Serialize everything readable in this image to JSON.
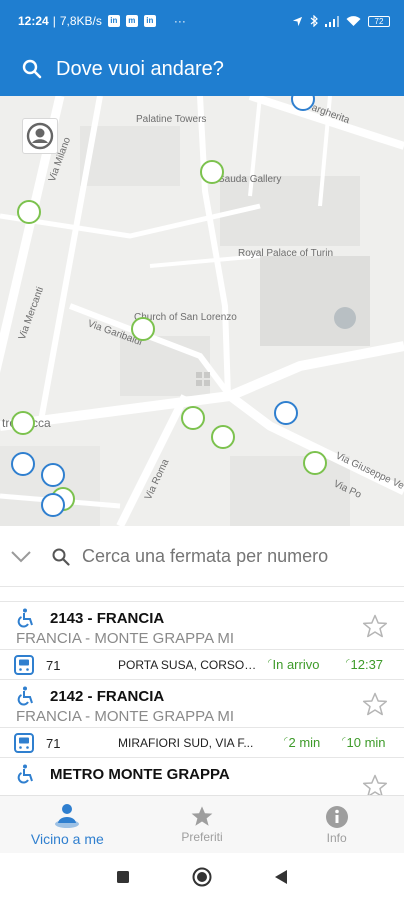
{
  "status_bar": {
    "time": "12:24",
    "network_speed": "7,8KB/s",
    "notifications": [
      "linkedin-icon",
      "messenger-icon",
      "linkedin-icon"
    ],
    "more": "···",
    "battery": "72"
  },
  "header": {
    "title": "Dove vuoi andare?",
    "color": "#1f7ed0"
  },
  "map": {
    "labels": {
      "palatine_towers": "Palatine Towers",
      "sauda_gallery": "Sauda Gallery",
      "royal_palace": "Royal Palace of Turin",
      "san_lorenzo": "Church of San Lorenzo",
      "via_milano": "Via Milano",
      "via_mercanti": "Via Mercanti",
      "via_garibaldi": "Via Garibaldi",
      "via_roma": "Via Roma",
      "via_po": "Via Po",
      "via_giuseppe_verdi": "Via Giuseppe Ve",
      "margherita": "argherita",
      "pietro_micca": "tro Micca"
    },
    "stop_colors": {
      "green": "#7cc24e",
      "blue": "#2f7fcf"
    }
  },
  "stop_search": {
    "placeholder": "Cerca una fermata per numero"
  },
  "stops": [
    {
      "title": "2143 - FRANCIA",
      "subtitle": "FRANCIA - MONTE GRAPPA MI",
      "line": {
        "number": "71",
        "destination": "PORTA SUSA, CORSO B...",
        "arrival_1": "In arrivo",
        "arrival_2": "12:37"
      }
    },
    {
      "title": "2142 - FRANCIA",
      "subtitle": "FRANCIA - MONTE GRAPPA MI",
      "line": {
        "number": "71",
        "destination": "MIRAFIORI SUD, VIA F...",
        "arrival_1": "2 min",
        "arrival_2": "10 min"
      }
    },
    {
      "title": "METRO MONTE GRAPPA"
    }
  ],
  "bottom_nav": {
    "nearby": "Vicino a me",
    "favorites": "Preferiti",
    "info": "Info"
  },
  "colors": {
    "accent": "#2f7fcf",
    "realtime_green": "#3e9b2a"
  }
}
